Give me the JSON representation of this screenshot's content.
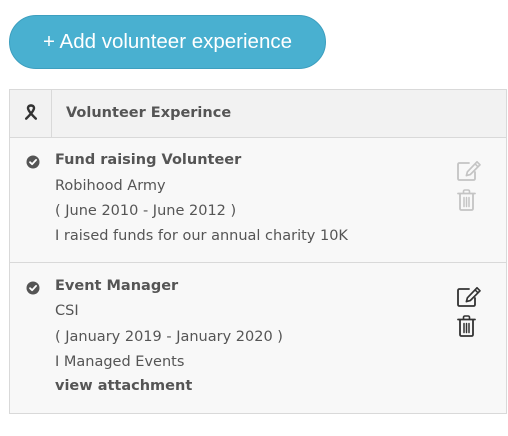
{
  "add_button": {
    "label": "+ Add volunteer experience"
  },
  "table": {
    "header_icon": "ribbon-icon",
    "header_title": "Volunteer Experince",
    "rows": [
      {
        "status_icon": "check-circle-icon",
        "role": "Fund raising Volunteer",
        "organization": "Robihood Army",
        "period": "( June 2010 - June 2012 )",
        "description": "I raised funds for our annual charity 10K",
        "actions_enabled": false,
        "edit_icon": "edit-icon",
        "delete_icon": "trash-icon"
      },
      {
        "status_icon": "check-circle-icon",
        "role": "Event Manager",
        "organization": "CSI",
        "period": "( January 2019 - January 2020 )",
        "description": "I Managed Events",
        "link": "view attachment",
        "actions_enabled": true,
        "edit_icon": "edit-icon",
        "delete_icon": "trash-icon"
      }
    ]
  },
  "colors": {
    "accent": "#49b0d0",
    "text": "#555555",
    "icon_disabled": "#c4c4c4",
    "icon_enabled": "#333333"
  }
}
